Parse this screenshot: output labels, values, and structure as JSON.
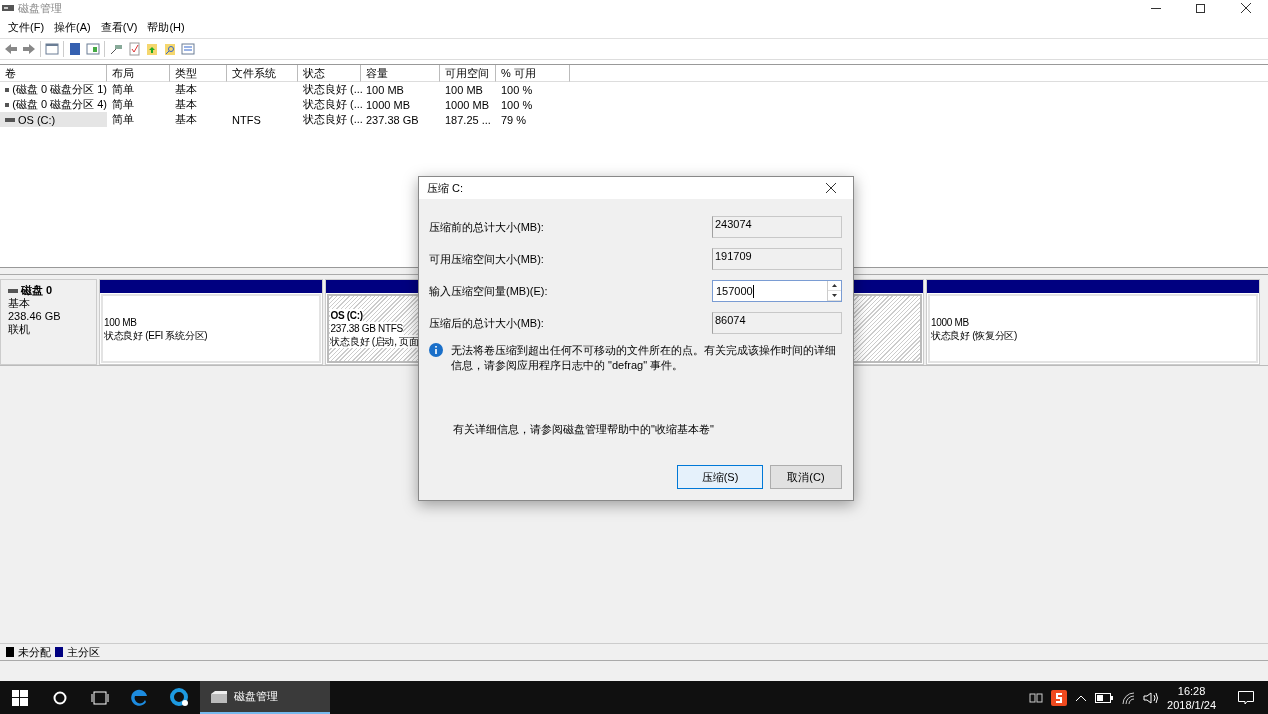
{
  "window": {
    "title": "磁盘管理"
  },
  "menu": [
    "文件(F)",
    "操作(A)",
    "查看(V)",
    "帮助(H)"
  ],
  "volume_table": {
    "columns": [
      "卷",
      "布局",
      "类型",
      "文件系统",
      "状态",
      "容量",
      "可用空间",
      "% 可用"
    ],
    "rows": [
      {
        "cells": [
          "(磁盘 0 磁盘分区 1)",
          "简单",
          "基本",
          "",
          "状态良好 (...",
          "100 MB",
          "100 MB",
          "100 %"
        ],
        "selected": false
      },
      {
        "cells": [
          "(磁盘 0 磁盘分区 4)",
          "简单",
          "基本",
          "",
          "状态良好 (...",
          "1000 MB",
          "1000 MB",
          "100 %"
        ],
        "selected": false
      },
      {
        "cells": [
          "OS (C:)",
          "简单",
          "基本",
          "NTFS",
          "状态良好 (...",
          "237.38 GB",
          "187.25 ...",
          "79 %"
        ],
        "selected": true
      }
    ]
  },
  "disk_map": {
    "disks": [
      {
        "name": "磁盘 0",
        "type": "基本",
        "size": "238.46 GB",
        "status": "联机",
        "partitions": [
          {
            "size": "100 MB",
            "status": "状态良好 (EFI 系统分区)",
            "selected": false
          },
          {
            "title": "OS  (C:)",
            "size": "237.38 GB NTFS",
            "status": "状态良好 (启动, 页面",
            "selected": true
          },
          {
            "size": "1000 MB",
            "status": "状态良好 (恢复分区)",
            "selected": false
          }
        ]
      }
    ]
  },
  "legend": [
    {
      "label": "未分配",
      "color": "#000000"
    },
    {
      "label": "主分区",
      "color": "#000080"
    }
  ],
  "dialog": {
    "title": "压缩 C:",
    "fields": [
      {
        "kind": "readonly",
        "label": "压缩前的总计大小(MB):",
        "value": "243074"
      },
      {
        "kind": "readonly",
        "label": "可用压缩空间大小(MB):",
        "value": "191709"
      },
      {
        "kind": "spin",
        "label": "输入压缩空间量(MB)(E):",
        "value": "157000"
      },
      {
        "kind": "readonly",
        "label": "压缩后的总计大小(MB):",
        "value": "86074"
      }
    ],
    "info": "无法将卷压缩到超出任何不可移动的文件所在的点。有关完成该操作时间的详细信息，请参阅应用程序日志中的 \"defrag\" 事件。",
    "help": "有关详细信息，请参阅磁盘管理帮助中的\"收缩基本卷\"",
    "buttons": [
      {
        "label": "压缩(S)",
        "default": true
      },
      {
        "label": "取消(C)",
        "default": false
      }
    ]
  },
  "taskbar": {
    "apps": [
      {
        "label": "磁盘管理",
        "active": true
      }
    ],
    "clock": {
      "time": "16:28",
      "date": "2018/1/24"
    }
  }
}
